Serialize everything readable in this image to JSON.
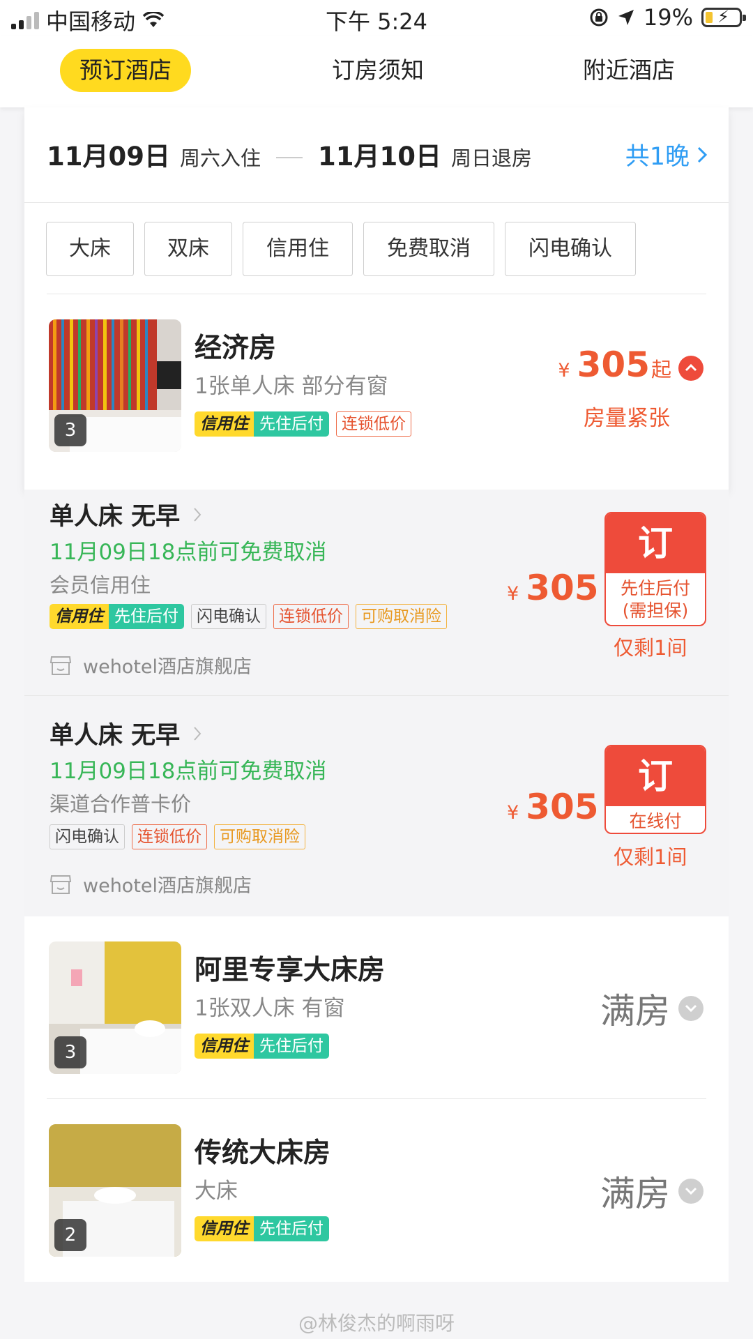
{
  "status_bar": {
    "carrier": "中国移动",
    "time": "下午 5:24",
    "battery": "19%"
  },
  "tabs": [
    {
      "label": "预订酒店"
    },
    {
      "label": "订房须知"
    },
    {
      "label": "附近酒店"
    }
  ],
  "stay": {
    "checkin_date": "11月09日",
    "checkin_label": "周六入住",
    "checkout_date": "11月10日",
    "checkout_label": "周日退房",
    "nights": "共1晚"
  },
  "filters": [
    {
      "label": "大床"
    },
    {
      "label": "双床"
    },
    {
      "label": "信用住"
    },
    {
      "label": "免费取消"
    },
    {
      "label": "闪电确认"
    }
  ],
  "credit_tag": {
    "a": "信用住",
    "b": "先住后付"
  },
  "rooms": [
    {
      "title": "经济房",
      "desc": "1张单人床 部分有窗",
      "photos": "3",
      "tag": "连锁低价",
      "yen": "¥",
      "price": "305",
      "suffix": "起",
      "status": "房量紧张"
    },
    {
      "title": "阿里专享大床房",
      "desc": "1张双人床 有窗",
      "photos": "3",
      "status": "满房"
    },
    {
      "title": "传统大床房",
      "desc": "大床",
      "photos": "2",
      "status": "满房"
    }
  ],
  "rates": [
    {
      "title": "单人床  无早",
      "cancel": "11月09日18点前可免费取消",
      "desc": "会员信用住",
      "tags": [
        "闪电确认",
        "连锁低价",
        "可购取消险"
      ],
      "store": "wehotel酒店旗舰店",
      "yen": "¥",
      "price": "305",
      "book": "订",
      "pay_line1": "先住后付",
      "pay_line2": "(需担保)",
      "remain": "仅剩1间"
    },
    {
      "title": "单人床  无早",
      "cancel": "11月09日18点前可免费取消",
      "desc": "渠道合作普卡价",
      "tags": [
        "闪电确认",
        "连锁低价",
        "可购取消险"
      ],
      "store": "wehotel酒店旗舰店",
      "yen": "¥",
      "price": "305",
      "book": "订",
      "pay_line1": "在线付",
      "remain": "仅剩1间"
    }
  ],
  "watermark": "@林俊杰的啊雨呀",
  "colors": {
    "accent_yellow": "#ffda1f",
    "price_red": "#ee5a32",
    "cancel_green": "#37b657",
    "link_blue": "#2f9df4"
  }
}
